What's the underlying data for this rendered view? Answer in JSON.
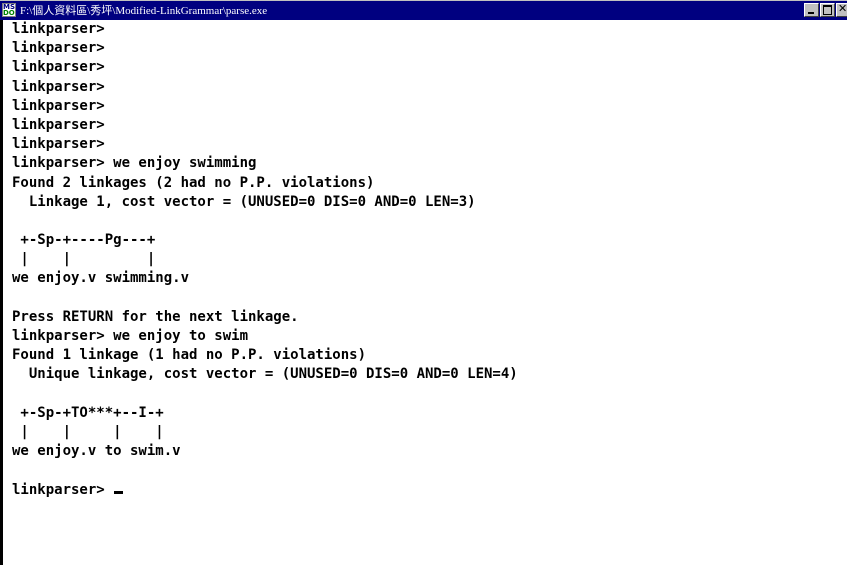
{
  "window": {
    "title": "F:\\個人資料區\\秀坪\\Modified-LinkGrammar\\parse.exe",
    "icon_text_top": "MS",
    "icon_text_bottom": "DOS"
  },
  "console": {
    "lines": [
      "linkparser>",
      "linkparser>",
      "linkparser>",
      "linkparser>",
      "linkparser>",
      "linkparser>",
      "linkparser>",
      "linkparser> we enjoy swimming",
      "Found 2 linkages (2 had no P.P. violations)",
      "  Linkage 1, cost vector = (UNUSED=0 DIS=0 AND=0 LEN=3)",
      "",
      " +-Sp-+----Pg---+",
      " |    |         |",
      "we enjoy.v swimming.v",
      "",
      "Press RETURN for the next linkage.",
      "linkparser> we enjoy to swim",
      "Found 1 linkage (1 had no P.P. violations)",
      "  Unique linkage, cost vector = (UNUSED=0 DIS=0 AND=0 LEN=4)",
      "",
      " +-Sp-+TO***+--I-+",
      " |    |     |    |",
      "we enjoy.v to swim.v",
      "",
      "linkparser> "
    ]
  },
  "colors": {
    "titlebar": "#000080",
    "background": "#ffffff",
    "text": "#000000"
  }
}
